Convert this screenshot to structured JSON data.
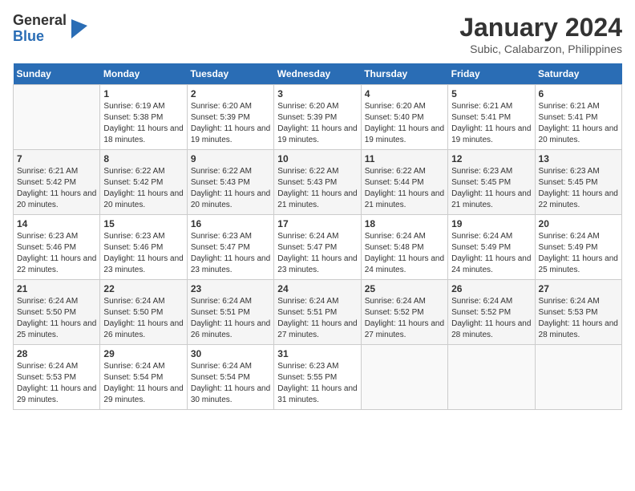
{
  "logo": {
    "general": "General",
    "blue": "Blue"
  },
  "title": "January 2024",
  "subtitle": "Subic, Calabarzon, Philippines",
  "weekdays": [
    "Sunday",
    "Monday",
    "Tuesday",
    "Wednesday",
    "Thursday",
    "Friday",
    "Saturday"
  ],
  "weeks": [
    [
      {
        "day": "",
        "sunrise": "",
        "sunset": "",
        "daylight": ""
      },
      {
        "day": "1",
        "sunrise": "Sunrise: 6:19 AM",
        "sunset": "Sunset: 5:38 PM",
        "daylight": "Daylight: 11 hours and 18 minutes."
      },
      {
        "day": "2",
        "sunrise": "Sunrise: 6:20 AM",
        "sunset": "Sunset: 5:39 PM",
        "daylight": "Daylight: 11 hours and 19 minutes."
      },
      {
        "day": "3",
        "sunrise": "Sunrise: 6:20 AM",
        "sunset": "Sunset: 5:39 PM",
        "daylight": "Daylight: 11 hours and 19 minutes."
      },
      {
        "day": "4",
        "sunrise": "Sunrise: 6:20 AM",
        "sunset": "Sunset: 5:40 PM",
        "daylight": "Daylight: 11 hours and 19 minutes."
      },
      {
        "day": "5",
        "sunrise": "Sunrise: 6:21 AM",
        "sunset": "Sunset: 5:41 PM",
        "daylight": "Daylight: 11 hours and 19 minutes."
      },
      {
        "day": "6",
        "sunrise": "Sunrise: 6:21 AM",
        "sunset": "Sunset: 5:41 PM",
        "daylight": "Daylight: 11 hours and 20 minutes."
      }
    ],
    [
      {
        "day": "7",
        "sunrise": "Sunrise: 6:21 AM",
        "sunset": "Sunset: 5:42 PM",
        "daylight": "Daylight: 11 hours and 20 minutes."
      },
      {
        "day": "8",
        "sunrise": "Sunrise: 6:22 AM",
        "sunset": "Sunset: 5:42 PM",
        "daylight": "Daylight: 11 hours and 20 minutes."
      },
      {
        "day": "9",
        "sunrise": "Sunrise: 6:22 AM",
        "sunset": "Sunset: 5:43 PM",
        "daylight": "Daylight: 11 hours and 20 minutes."
      },
      {
        "day": "10",
        "sunrise": "Sunrise: 6:22 AM",
        "sunset": "Sunset: 5:43 PM",
        "daylight": "Daylight: 11 hours and 21 minutes."
      },
      {
        "day": "11",
        "sunrise": "Sunrise: 6:22 AM",
        "sunset": "Sunset: 5:44 PM",
        "daylight": "Daylight: 11 hours and 21 minutes."
      },
      {
        "day": "12",
        "sunrise": "Sunrise: 6:23 AM",
        "sunset": "Sunset: 5:45 PM",
        "daylight": "Daylight: 11 hours and 21 minutes."
      },
      {
        "day": "13",
        "sunrise": "Sunrise: 6:23 AM",
        "sunset": "Sunset: 5:45 PM",
        "daylight": "Daylight: 11 hours and 22 minutes."
      }
    ],
    [
      {
        "day": "14",
        "sunrise": "Sunrise: 6:23 AM",
        "sunset": "Sunset: 5:46 PM",
        "daylight": "Daylight: 11 hours and 22 minutes."
      },
      {
        "day": "15",
        "sunrise": "Sunrise: 6:23 AM",
        "sunset": "Sunset: 5:46 PM",
        "daylight": "Daylight: 11 hours and 23 minutes."
      },
      {
        "day": "16",
        "sunrise": "Sunrise: 6:23 AM",
        "sunset": "Sunset: 5:47 PM",
        "daylight": "Daylight: 11 hours and 23 minutes."
      },
      {
        "day": "17",
        "sunrise": "Sunrise: 6:24 AM",
        "sunset": "Sunset: 5:47 PM",
        "daylight": "Daylight: 11 hours and 23 minutes."
      },
      {
        "day": "18",
        "sunrise": "Sunrise: 6:24 AM",
        "sunset": "Sunset: 5:48 PM",
        "daylight": "Daylight: 11 hours and 24 minutes."
      },
      {
        "day": "19",
        "sunrise": "Sunrise: 6:24 AM",
        "sunset": "Sunset: 5:49 PM",
        "daylight": "Daylight: 11 hours and 24 minutes."
      },
      {
        "day": "20",
        "sunrise": "Sunrise: 6:24 AM",
        "sunset": "Sunset: 5:49 PM",
        "daylight": "Daylight: 11 hours and 25 minutes."
      }
    ],
    [
      {
        "day": "21",
        "sunrise": "Sunrise: 6:24 AM",
        "sunset": "Sunset: 5:50 PM",
        "daylight": "Daylight: 11 hours and 25 minutes."
      },
      {
        "day": "22",
        "sunrise": "Sunrise: 6:24 AM",
        "sunset": "Sunset: 5:50 PM",
        "daylight": "Daylight: 11 hours and 26 minutes."
      },
      {
        "day": "23",
        "sunrise": "Sunrise: 6:24 AM",
        "sunset": "Sunset: 5:51 PM",
        "daylight": "Daylight: 11 hours and 26 minutes."
      },
      {
        "day": "24",
        "sunrise": "Sunrise: 6:24 AM",
        "sunset": "Sunset: 5:51 PM",
        "daylight": "Daylight: 11 hours and 27 minutes."
      },
      {
        "day": "25",
        "sunrise": "Sunrise: 6:24 AM",
        "sunset": "Sunset: 5:52 PM",
        "daylight": "Daylight: 11 hours and 27 minutes."
      },
      {
        "day": "26",
        "sunrise": "Sunrise: 6:24 AM",
        "sunset": "Sunset: 5:52 PM",
        "daylight": "Daylight: 11 hours and 28 minutes."
      },
      {
        "day": "27",
        "sunrise": "Sunrise: 6:24 AM",
        "sunset": "Sunset: 5:53 PM",
        "daylight": "Daylight: 11 hours and 28 minutes."
      }
    ],
    [
      {
        "day": "28",
        "sunrise": "Sunrise: 6:24 AM",
        "sunset": "Sunset: 5:53 PM",
        "daylight": "Daylight: 11 hours and 29 minutes."
      },
      {
        "day": "29",
        "sunrise": "Sunrise: 6:24 AM",
        "sunset": "Sunset: 5:54 PM",
        "daylight": "Daylight: 11 hours and 29 minutes."
      },
      {
        "day": "30",
        "sunrise": "Sunrise: 6:24 AM",
        "sunset": "Sunset: 5:54 PM",
        "daylight": "Daylight: 11 hours and 30 minutes."
      },
      {
        "day": "31",
        "sunrise": "Sunrise: 6:23 AM",
        "sunset": "Sunset: 5:55 PM",
        "daylight": "Daylight: 11 hours and 31 minutes."
      },
      {
        "day": "",
        "sunrise": "",
        "sunset": "",
        "daylight": ""
      },
      {
        "day": "",
        "sunrise": "",
        "sunset": "",
        "daylight": ""
      },
      {
        "day": "",
        "sunrise": "",
        "sunset": "",
        "daylight": ""
      }
    ]
  ]
}
